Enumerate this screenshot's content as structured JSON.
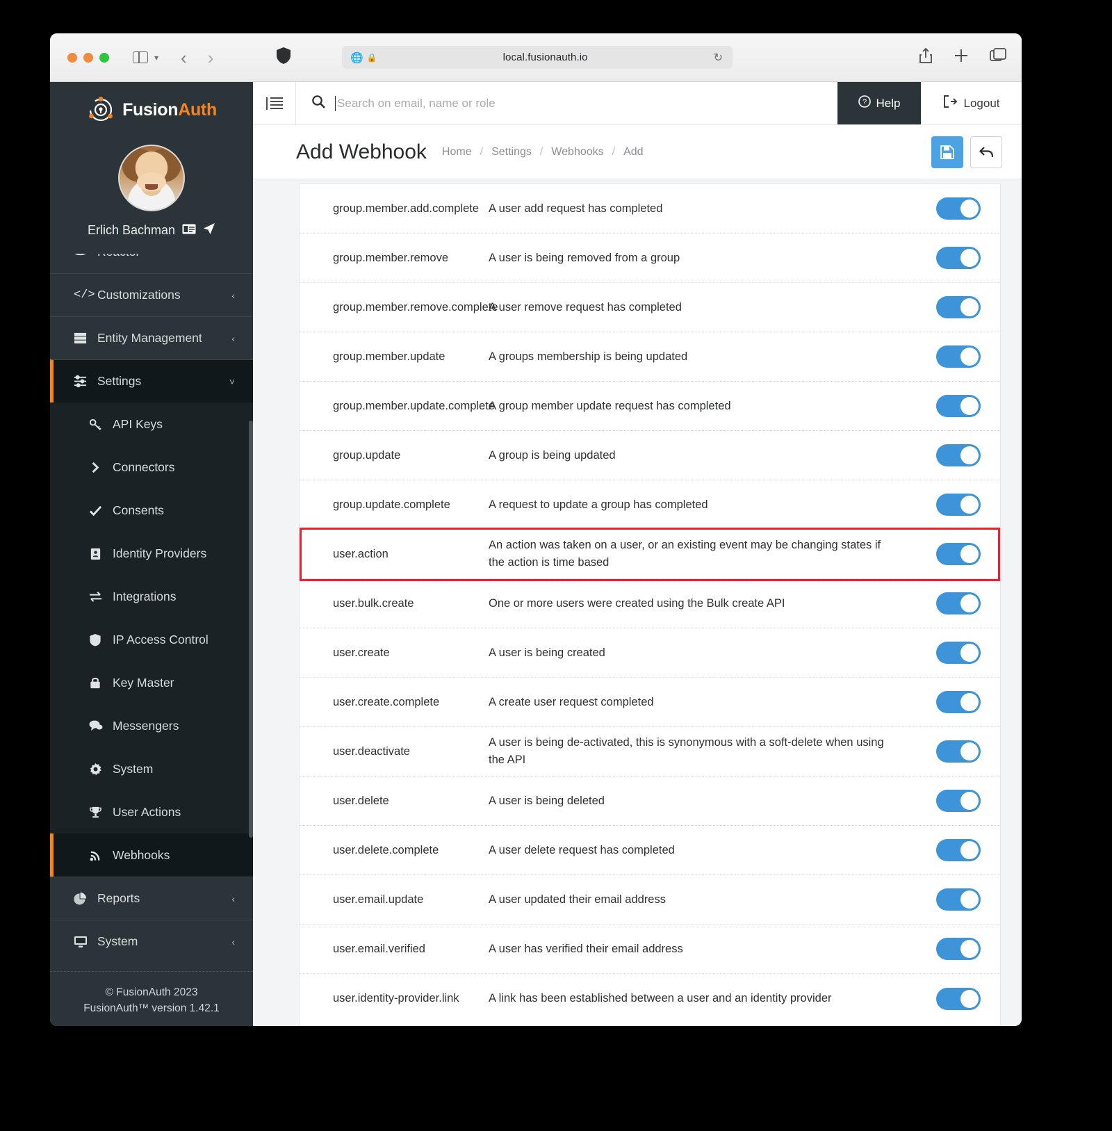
{
  "browser": {
    "url": "local.fusionauth.io",
    "reload_icon": "reload-icon",
    "share_icon": "share-icon",
    "newtab_icon": "plus-icon",
    "tabs_icon": "tabs-icon",
    "shield_icon": "shield-icon",
    "back_icon": "back-chevron-icon",
    "forward_icon": "forward-chevron-icon",
    "sidebar_icon": "sidebar-icon",
    "globe_icon": "globe-icon",
    "lock_icon": "lock-icon"
  },
  "sidebar": {
    "brand_first": "Fusion",
    "brand_second": "Auth",
    "user_name": "Erlich Bachman",
    "user_badge_icon": "id-card-icon",
    "user_locate_icon": "send-icon",
    "items": [
      {
        "label": "Reactor",
        "icon": "reactor-icon",
        "chevron": "",
        "state": "partial"
      },
      {
        "label": "Customizations",
        "icon": "code-icon",
        "chevron": "‹",
        "state": "group"
      },
      {
        "label": "Entity Management",
        "icon": "server-icon",
        "chevron": "‹",
        "state": "group"
      },
      {
        "label": "Settings",
        "icon": "sliders-icon",
        "chevron": "˅",
        "state": "active-group"
      },
      {
        "label": "API Keys",
        "icon": "key-icon",
        "chevron": "",
        "state": "sub"
      },
      {
        "label": "Connectors",
        "icon": "chevron-right-icon",
        "chevron": "",
        "state": "sub"
      },
      {
        "label": "Consents",
        "icon": "check-icon",
        "chevron": "",
        "state": "sub"
      },
      {
        "label": "Identity Providers",
        "icon": "id-badge-icon",
        "chevron": "",
        "state": "sub"
      },
      {
        "label": "Integrations",
        "icon": "exchange-icon",
        "chevron": "",
        "state": "sub"
      },
      {
        "label": "IP Access Control",
        "icon": "shield-icon",
        "chevron": "",
        "state": "sub"
      },
      {
        "label": "Key Master",
        "icon": "lock-icon",
        "chevron": "",
        "state": "sub"
      },
      {
        "label": "Messengers",
        "icon": "comments-icon",
        "chevron": "",
        "state": "sub"
      },
      {
        "label": "System",
        "icon": "gear-icon",
        "chevron": "",
        "state": "sub"
      },
      {
        "label": "User Actions",
        "icon": "trophy-icon",
        "chevron": "",
        "state": "sub"
      },
      {
        "label": "Webhooks",
        "icon": "rss-icon",
        "chevron": "",
        "state": "sub-active"
      },
      {
        "label": "Reports",
        "icon": "pie-chart-icon",
        "chevron": "‹",
        "state": "group"
      },
      {
        "label": "System",
        "icon": "desktop-icon",
        "chevron": "‹",
        "state": "group"
      }
    ],
    "footer_line1": "© FusionAuth 2023",
    "footer_line2": "FusionAuth™ version 1.42.1"
  },
  "topbar": {
    "menu_toggle_icon": "collapse-menu-icon",
    "search_icon": "search-icon",
    "search_value": "",
    "search_placeholder": "Search on email, name or role",
    "help_label": "Help",
    "help_icon": "question-circle-icon",
    "logout_label": "Logout",
    "logout_icon": "sign-out-icon"
  },
  "page": {
    "title": "Add Webhook",
    "breadcrumbs": [
      "Home",
      "Settings",
      "Webhooks",
      "Add"
    ],
    "separator": "/",
    "save_icon": "save-icon",
    "back_icon": "undo-arrow-icon"
  },
  "events": {
    "toggle_color": "#3d94d9",
    "highlight_color": "#f21f2e",
    "rows": [
      {
        "name": "group.member.add.complete",
        "description": "A user add request has completed",
        "enabled": true,
        "highlighted": false
      },
      {
        "name": "group.member.remove",
        "description": "A user is being removed from a group",
        "enabled": true,
        "highlighted": false
      },
      {
        "name": "group.member.remove.complete",
        "description": "A user remove request has completed",
        "enabled": true,
        "highlighted": false
      },
      {
        "name": "group.member.update",
        "description": "A groups membership is being updated",
        "enabled": true,
        "highlighted": false
      },
      {
        "name": "group.member.update.complete",
        "description": "A group member update request has completed",
        "enabled": true,
        "highlighted": false
      },
      {
        "name": "group.update",
        "description": "A group is being updated",
        "enabled": true,
        "highlighted": false
      },
      {
        "name": "group.update.complete",
        "description": "A request to update a group has completed",
        "enabled": true,
        "highlighted": false
      },
      {
        "name": "user.action",
        "description": "An action was taken on a user, or an existing event may be changing states if the action is time based",
        "enabled": true,
        "highlighted": true
      },
      {
        "name": "user.bulk.create",
        "description": "One or more users were created using the Bulk create API",
        "enabled": true,
        "highlighted": false
      },
      {
        "name": "user.create",
        "description": "A user is being created",
        "enabled": true,
        "highlighted": false
      },
      {
        "name": "user.create.complete",
        "description": "A create user request completed",
        "enabled": true,
        "highlighted": false
      },
      {
        "name": "user.deactivate",
        "description": "A user is being de-activated, this is synonymous with a soft-delete when using the API",
        "enabled": true,
        "highlighted": false
      },
      {
        "name": "user.delete",
        "description": "A user is being deleted",
        "enabled": true,
        "highlighted": false
      },
      {
        "name": "user.delete.complete",
        "description": "A user delete request has completed",
        "enabled": true,
        "highlighted": false
      },
      {
        "name": "user.email.update",
        "description": "A user updated their email address",
        "enabled": true,
        "highlighted": false
      },
      {
        "name": "user.email.verified",
        "description": "A user has verified their email address",
        "enabled": true,
        "highlighted": false
      },
      {
        "name": "user.identity-provider.link",
        "description": "A link has been established between a user and an identity provider",
        "enabled": true,
        "highlighted": false
      }
    ]
  }
}
